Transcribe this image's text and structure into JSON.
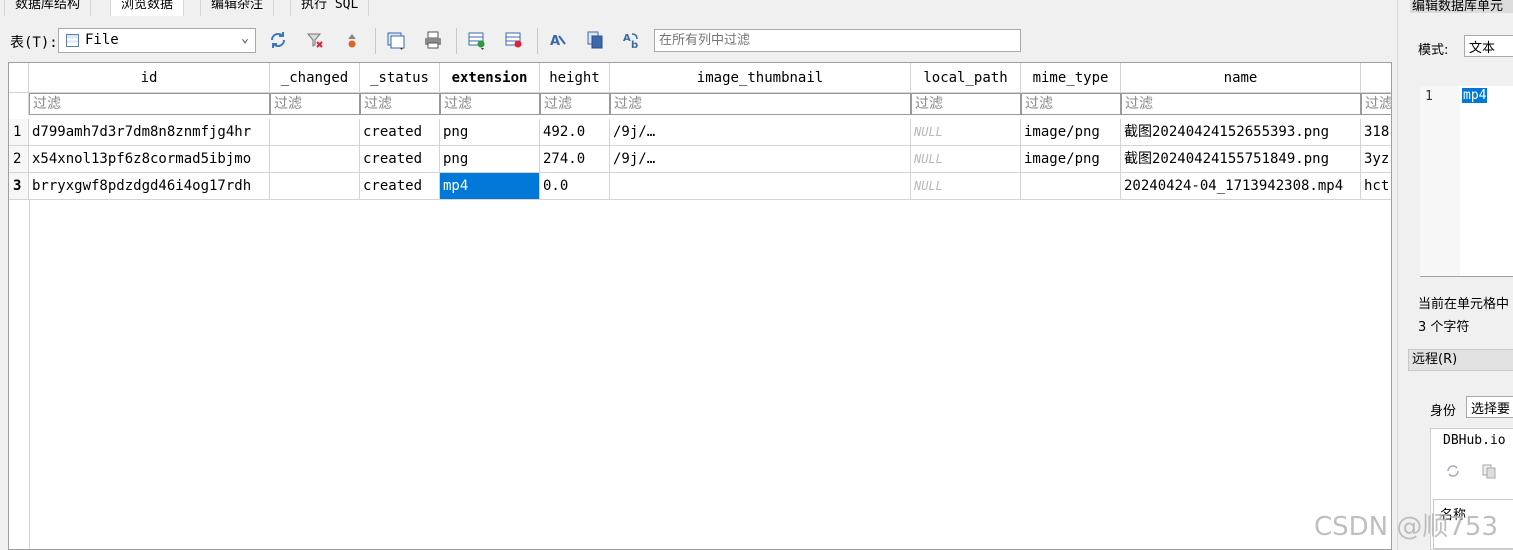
{
  "tabs": [
    "数据库结构",
    "浏览数据",
    "编辑杂注",
    "执行 SQL"
  ],
  "toolbar": {
    "table_label": "表(T):",
    "table_value": "File",
    "filter_placeholder": "在所有列中过滤"
  },
  "grid": {
    "columns": [
      "id",
      "_changed",
      "_status",
      "extension",
      "height",
      "image_thumbnail",
      "local_path",
      "mime_type",
      "name",
      ""
    ],
    "filter_placeholder": "过滤",
    "rows": [
      {
        "num": "1",
        "cells": [
          "d799amh7d3r7dm8n8znmfjg4hr",
          "",
          "created",
          "png",
          "492.0",
          "/9j/…",
          "NULL",
          "image/png",
          "截图20240424152655393.png",
          "318"
        ]
      },
      {
        "num": "2",
        "cells": [
          "x54xnol13pf6z8cormad5ibjmo",
          "",
          "created",
          "png",
          "274.0",
          "/9j/…",
          "NULL",
          "image/png",
          "截图20240424155751849.png",
          "3yz"
        ]
      },
      {
        "num": "3",
        "cells": [
          "brryxgwf8pdzdgd46i4og17rdh",
          "",
          "created",
          "mp4",
          "0.0",
          "",
          "NULL",
          "",
          "20240424-04_1713942308.mp4",
          "hct"
        ]
      }
    ]
  },
  "right_panel": {
    "title": "编辑数据库单元",
    "mode_label": "模式:",
    "mode_value": "文本",
    "editor_line": "1",
    "editor_text": "mp4",
    "status_line1": "当前在单元格中",
    "status_line2": "3 个字符",
    "remote_label": "远程(R)",
    "identity_label": "身份",
    "identity_value": "选择要",
    "dbhub_label": "DBHub.io",
    "name_label": "名称"
  },
  "watermark": "CSDN @顺753"
}
